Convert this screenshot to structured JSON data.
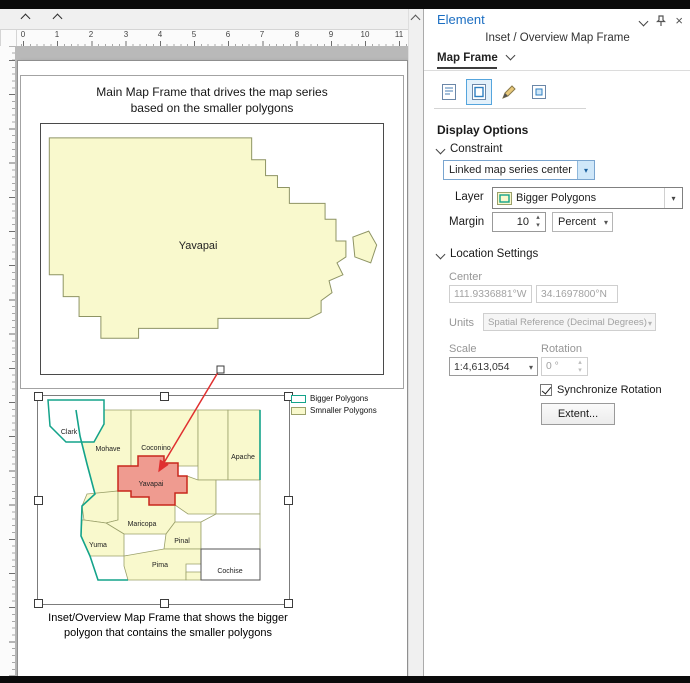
{
  "icons": {
    "dropdown": "▾",
    "spinner_up": "▴",
    "spinner_down": "▾",
    "close": "×"
  },
  "ruler": {
    "numbers": [
      "0",
      "1",
      "2",
      "3",
      "4",
      "5",
      "6",
      "7",
      "8",
      "9",
      "10",
      "11"
    ]
  },
  "layout": {
    "main_frame": {
      "title_line1": "Main Map Frame that drives the map series",
      "title_line2": "based on the smaller polygons",
      "label": "Yavapai"
    },
    "legend": {
      "items": [
        {
          "label": "Bigger Polygons"
        },
        {
          "label": "Smnaller Polygons"
        }
      ]
    },
    "inset": {
      "labels": [
        "Clark",
        "Mohave",
        "Coconino",
        "Apache",
        "Yavapai",
        "Maricopa",
        "Yuma",
        "Pinal",
        "Pima",
        "Cochise"
      ]
    },
    "caption_line1": "Inset/Overview Map Frame that shows the bigger",
    "caption_line2": "polygon that contains the smaller polygons"
  },
  "panel": {
    "title": "Element",
    "subtitle": "Inset / Overview Map Frame",
    "tab_label": "Map Frame",
    "display_options_heading": "Display Options",
    "constraint": {
      "heading": "Constraint",
      "type_value": "Linked map series center",
      "layer_label": "Layer",
      "layer_value": "Bigger Polygons",
      "margin_label": "Margin",
      "margin_value": "10",
      "margin_unit": "Percent"
    },
    "location": {
      "heading": "Location Settings",
      "center_label": "Center",
      "center_lon": "111.9336881°W",
      "center_lat": "34.1697800°N",
      "units_label": "Units",
      "units_value": "Spatial Reference (Decimal Degrees)",
      "scale_label": "Scale",
      "scale_value": "1:4,613,054",
      "rotation_label": "Rotation",
      "rotation_value": "0 °",
      "sync_rotation_label": "Synchronize Rotation",
      "extent_button": "Extent..."
    }
  },
  "colors": {
    "accent_blue": "#1b6ec2",
    "combo_focus": "#7aa5cf",
    "dropdown_highlight": "#cfe7f9",
    "polygon_yellow": "#f9f9cd",
    "bigger_polygon_teal": "#14a38a",
    "yavapai_fill": "#ef9b90",
    "yavapai_stroke": "#c8281c",
    "arrow_red": "#e03030"
  }
}
